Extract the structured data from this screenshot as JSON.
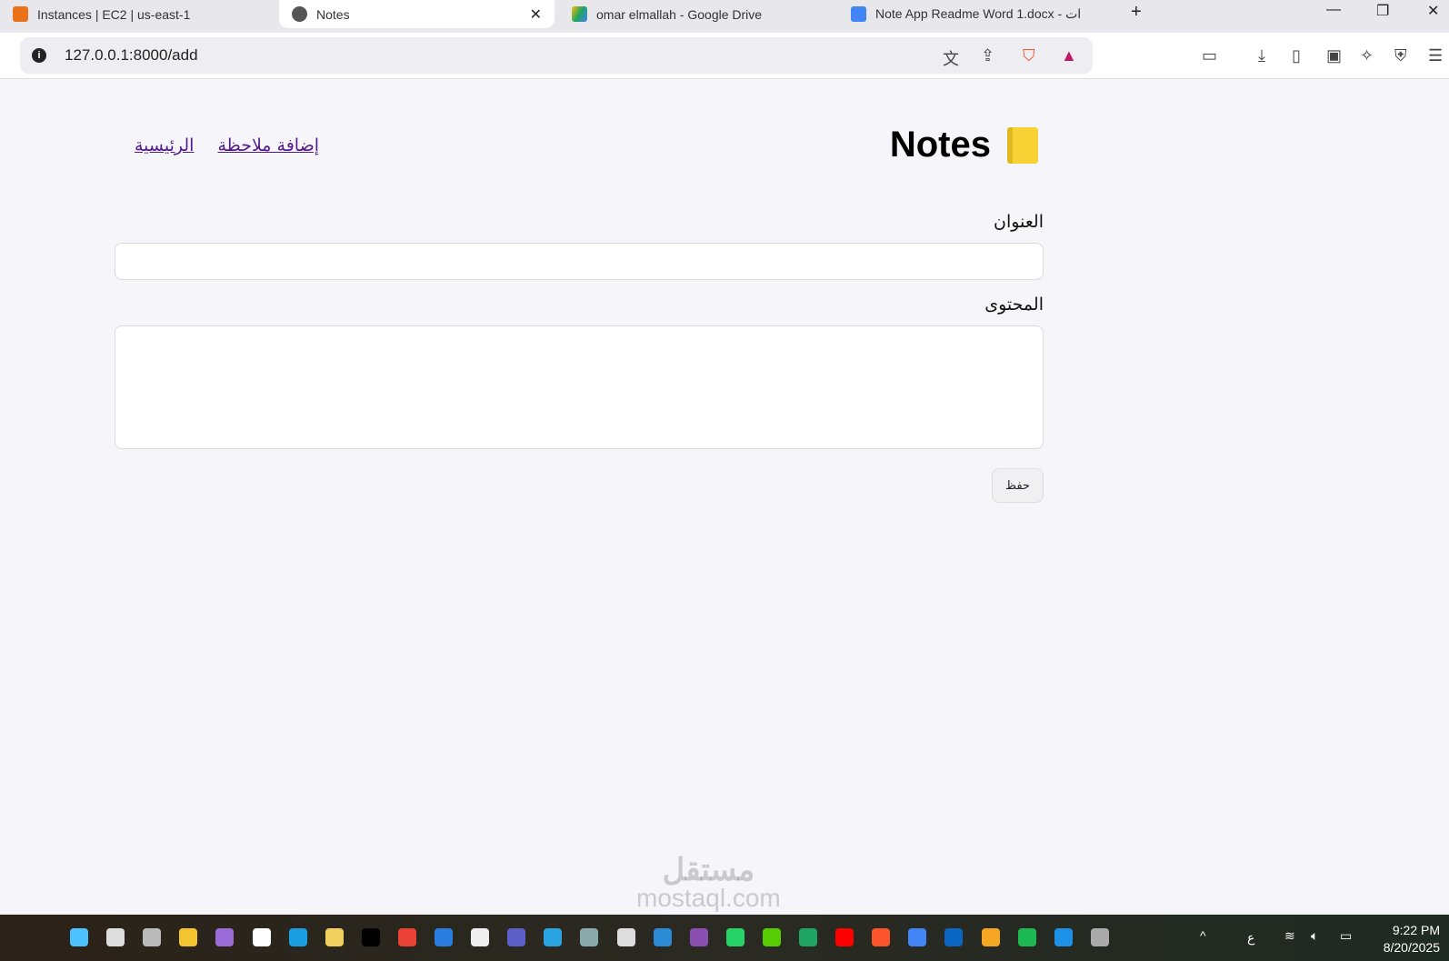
{
  "browser": {
    "tabs": [
      {
        "title": "Instances | EC2 | us-east-1",
        "color": "#e8731a"
      },
      {
        "title": "Notes",
        "color": "#555",
        "active": true
      },
      {
        "title": "omar elmallah - Google Drive",
        "color": "#1fa463"
      },
      {
        "title": "Note App Readme Word 1.docx - ات",
        "color": "#4285f4"
      }
    ],
    "close_glyph": "✕",
    "new_tab_glyph": "+",
    "url": "127.0.0.1:8000/add"
  },
  "page": {
    "brand": "Notes",
    "nav": {
      "home": "الرئيسية",
      "add": "إضافة ملاحظة"
    },
    "form": {
      "title_label": "العنوان",
      "title_value": "",
      "content_label": "المحتوى",
      "content_value": "",
      "save_label": "حفظ"
    }
  },
  "watermark": {
    "ar": "مستقل",
    "en": "mostaql.com"
  },
  "taskbar": {
    "icons": [
      "start",
      "search",
      "task-view",
      "file-explorer",
      "copilot",
      "store",
      "edge",
      "app-e",
      "app-r",
      "gmail",
      "todo",
      "github",
      "teams",
      "telegram",
      "snipping",
      "chatgpt",
      "vscode",
      "app-m",
      "whatsapp",
      "duolingo",
      "google-drive",
      "youtube",
      "brave",
      "chrome",
      "linkedin",
      "weather",
      "spotify",
      "docker",
      "settings"
    ],
    "lang": "ع",
    "time": "9:22 PM",
    "date": "8/20/2025"
  }
}
